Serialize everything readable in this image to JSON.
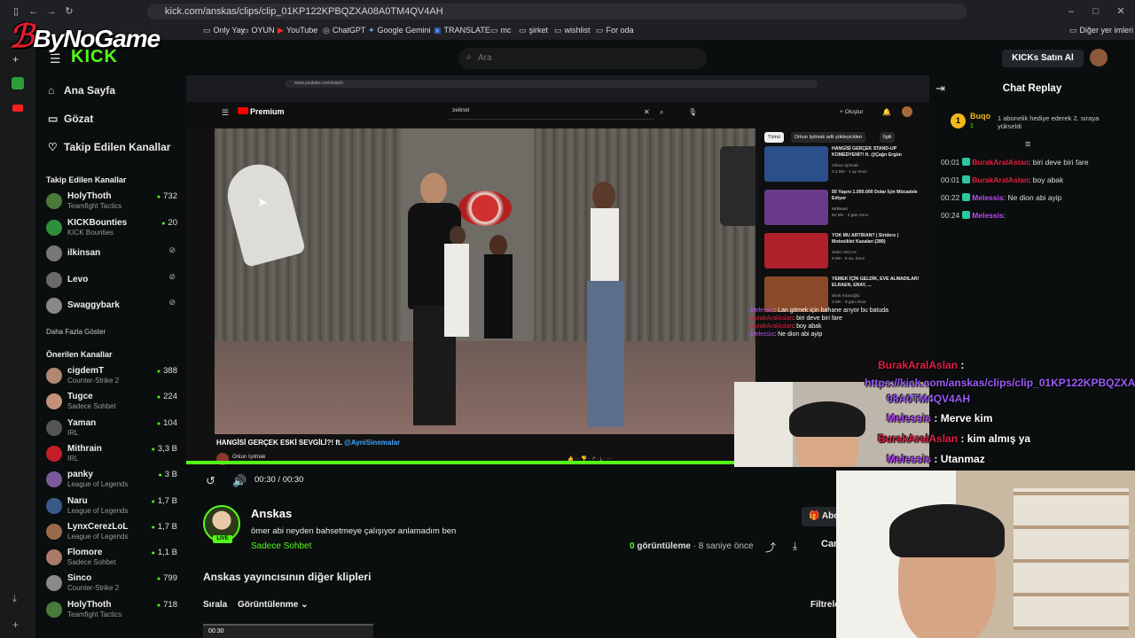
{
  "browser": {
    "url": "kick.com/anskas/clips/clip_01KP122KPBQZXA08A0TM4QV4AH",
    "bookmarks": [
      "Only Yay",
      "OYUN",
      "YouTube",
      "ChatGPT",
      "Google Gemini",
      "TRANSLATE",
      "mc",
      "şirket",
      "wishlist",
      "For oda"
    ],
    "other_bookmarks": "Diğer yer imleri"
  },
  "branding": {
    "overlay_logo": "ByNoGame",
    "kick_logo": "KICK"
  },
  "header": {
    "search_placeholder": "Ara",
    "buy_kicks": "KICKs Satın Al"
  },
  "sidebar": {
    "nav": [
      "Ana Sayfa",
      "Gözat",
      "Takip Edilen Kanallar"
    ],
    "followed_title": "Takip Edilen Kanallar",
    "followed": [
      {
        "name": "HolyThoth",
        "category": "Teamfight Tactics",
        "viewers": "732",
        "color": "#4a7a3a"
      },
      {
        "name": "KICKBounties",
        "category": "KICK Bounties",
        "viewers": "20",
        "color": "#2f8f3a"
      },
      {
        "name": "ilkinsan",
        "category": "",
        "viewers": "",
        "color": "#777"
      },
      {
        "name": "Levo",
        "category": "",
        "viewers": "",
        "color": "#6a6a6a"
      },
      {
        "name": "Swaggybark",
        "category": "",
        "viewers": "",
        "color": "#888"
      }
    ],
    "show_more": "Daha Fazla Göster",
    "recommended_title": "Önerilen Kanallar",
    "recommended": [
      {
        "name": "cigdemT",
        "category": "Counter-Strike 2",
        "viewers": "388",
        "color": "#b08870"
      },
      {
        "name": "Tugce",
        "category": "Sadece Sohbet",
        "viewers": "224",
        "color": "#c4907a"
      },
      {
        "name": "Yaman",
        "category": "IRL",
        "viewers": "104",
        "color": "#555"
      },
      {
        "name": "Mithrain",
        "category": "IRL",
        "viewers": "3,3 B",
        "color": "#c21e2a"
      },
      {
        "name": "panky",
        "category": "League of Legends",
        "viewers": "3 B",
        "color": "#7a5a9a"
      },
      {
        "name": "Naru",
        "category": "League of Legends",
        "viewers": "1,7 B",
        "color": "#3a5a8a"
      },
      {
        "name": "LynxCerezLoL",
        "category": "League of Legends",
        "viewers": "1,7 B",
        "color": "#9a6a4a"
      },
      {
        "name": "Flomore",
        "category": "Sadece Sohbet",
        "viewers": "1,1 B",
        "color": "#aa7a6a"
      },
      {
        "name": "Sinco",
        "category": "Counter-Strike 2",
        "viewers": "799",
        "color": "#8a8a8a"
      },
      {
        "name": "HolyThoth",
        "category": "Teamfight Tactics",
        "viewers": "718",
        "color": "#4a7a3a"
      }
    ]
  },
  "inner_youtube": {
    "search_value": "zeitnot",
    "create": "Oluştur",
    "chips": [
      "Tümü",
      "Orkun Işıtmak adlı yükleyiciden",
      "İlgili"
    ],
    "video_title": "HANGİSİ GERÇEK ESKİ SEVGİLİ?! ft.",
    "video_mention": "@AyniSinemalar",
    "channel": "Orkun Işıtmak",
    "recs": [
      {
        "title": "HANGİSİ GERÇEK STAND-UP KOMEDYENİ?! ft. @Çağrı Ergün",
        "channel": "Orkun Işıtmak",
        "meta": "2,4 Mn · 1 ay önce",
        "color": "#2a4f8a"
      },
      {
        "title": "50 Yaşını 1.000.000 Dolar İçin Mücadele Ediyor",
        "channel": "MrBeast",
        "meta": "52 Mn · 3 gün önce",
        "color": "#6a3a8a"
      },
      {
        "title": "YOK MU ARTIRAN? | Siriders | Motosiklet Kazaları (289)",
        "channel": "Zafer AKCAY",
        "meta": "8 Mn · 6 sa. önce",
        "color": "#b0202a"
      },
      {
        "title": "YEMEK İÇİN GELDİK, EVE ALMADILAR! ELRAEN, ERAY, ...",
        "channel": "Elvis Kirazoğlu",
        "meta": "3 Mn · 9 gün önce",
        "color": "#8a4a2a"
      }
    ],
    "overlay_chat": [
      {
        "user": "Melessis",
        "text": ": Lan gitmek için bahane arıyor bu batuda",
        "color": "#b84cf5"
      },
      {
        "user": "BurakAralAslan",
        "text": ": biri deve biri fare",
        "color": "#e02040"
      },
      {
        "user": "BurakAralAslan",
        "text": ": boy abak",
        "color": "#e02040"
      },
      {
        "user": "Melessis",
        "text": ": Ne dion abi ayip",
        "color": "#b84cf5"
      }
    ]
  },
  "player": {
    "time": "00:30 / 00:30",
    "progress": 1.0
  },
  "clip": {
    "streamer": "Anskas",
    "live": "LIVE",
    "title": "ömer abi neyden bahsetmeye çalışıyor anlamadım ben",
    "category": "Sadece Sohbet",
    "views_count": "0",
    "views_label": "görüntüleme",
    "age": "· 8 saniye önce",
    "subscribe": "Abo",
    "cancel": "Can",
    "other_clips": "Anskas yayıncısının diğer klipleri",
    "sort_label": "Sırala",
    "sort_value": "Görüntülenme",
    "filter": "Filtrele",
    "thumb_time": "00:30"
  },
  "chat": {
    "title": "Chat Replay",
    "gift_rank": "1",
    "gift_user": "Buqo",
    "gift_count": "1",
    "gift_text": "1 abonelik hediye ederek 2. sıraya yükseldi",
    "messages": [
      {
        "time": "00:01",
        "user": "BurakAralAslan",
        "text": ": biri deve biri fare",
        "color": "#e02040"
      },
      {
        "time": "00:01",
        "user": "BurakAralAslan",
        "text": ": boy abak",
        "color": "#e02040"
      },
      {
        "time": "00:22",
        "user": "Melessis",
        "text": ": Ne dion abi ayip",
        "color": "#b84cf5"
      },
      {
        "time": "00:24",
        "user": "Melessis",
        "text": ":",
        "color": "#b84cf5"
      }
    ]
  },
  "overlay_big_chat": [
    {
      "user": "BurakAralAslan",
      "text": " :",
      "color": "#e0204a"
    },
    {
      "user": "https://kick.com/anskas/clips/clip_01KP122KPBQZXA",
      "text": "",
      "color": "#9b5cf7"
    },
    {
      "user": "08A0TM4QV4AH",
      "text": "",
      "color": "#9b5cf7"
    },
    {
      "user": "Melessis",
      "text": " : Merve kim",
      "color": "#b84cf5"
    },
    {
      "user": "BurakAralAslan",
      "text": " : kim almış ya",
      "color": "#e0204a"
    },
    {
      "user": "Melessis",
      "text": " : Utanmaz",
      "color": "#b84cf5"
    }
  ]
}
